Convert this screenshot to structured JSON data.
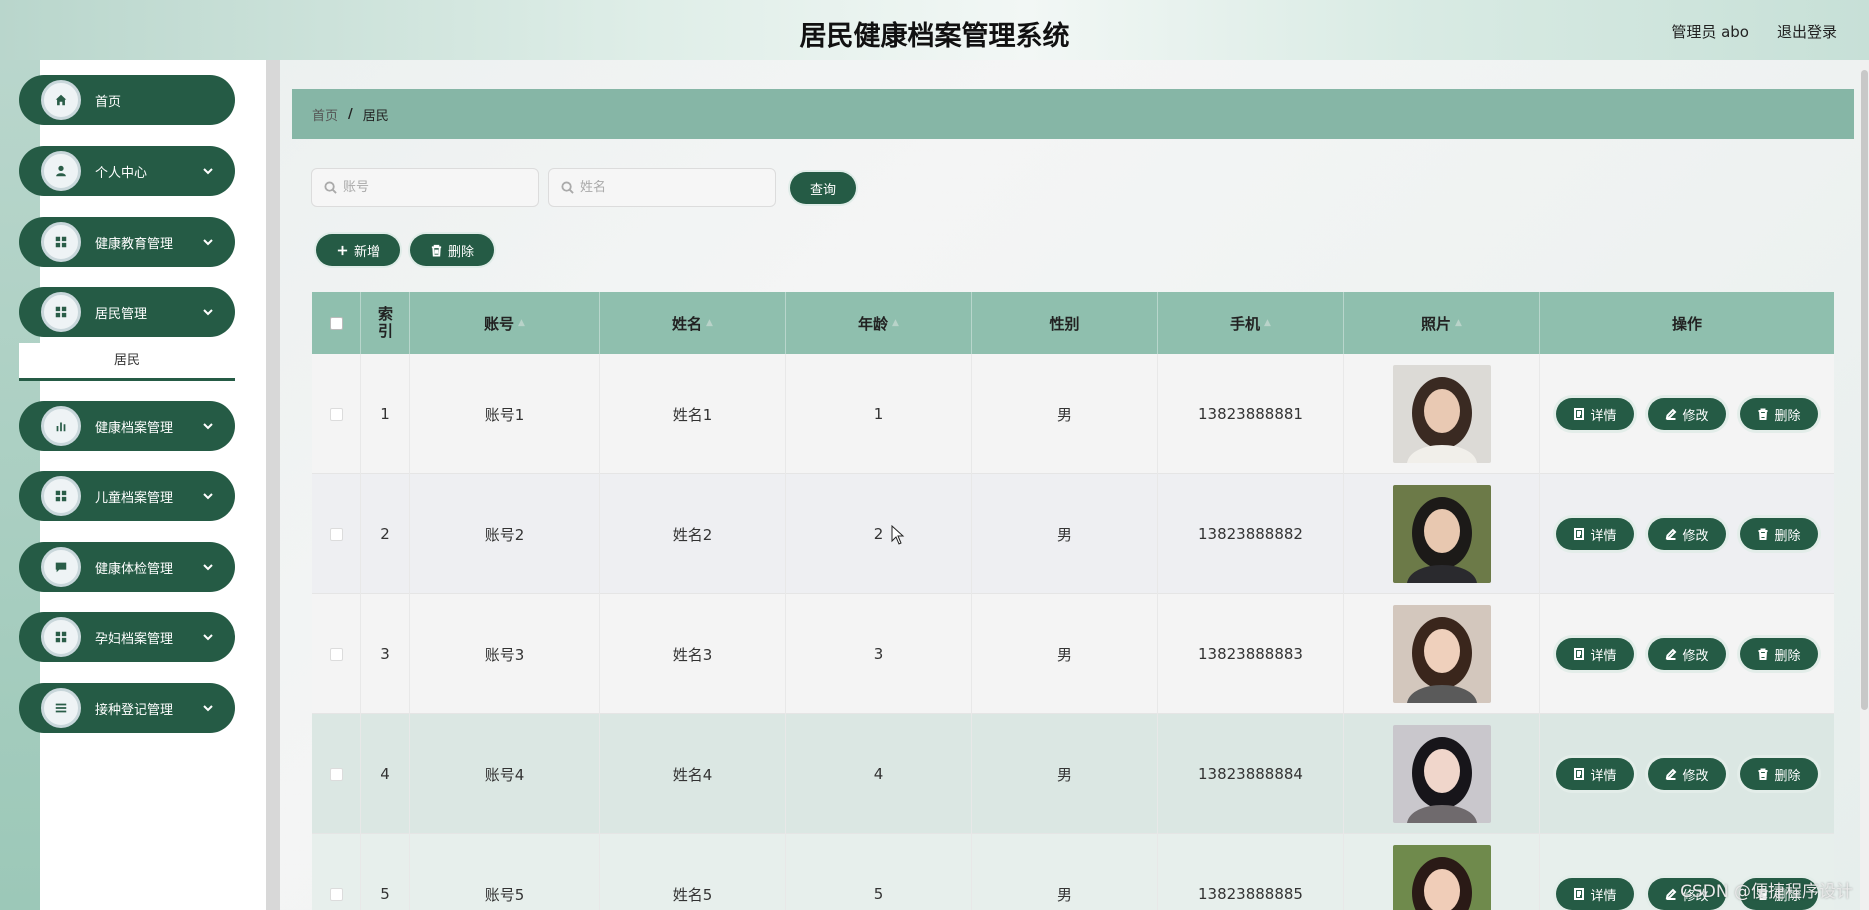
{
  "header": {
    "title": "居民健康档案管理系统",
    "user": "管理员 abo",
    "logout": "退出登录"
  },
  "sidebar": {
    "items": [
      {
        "label": "首页",
        "icon": "home-icon",
        "expandable": false
      },
      {
        "label": "个人中心",
        "icon": "user-icon",
        "expandable": true
      },
      {
        "label": "健康教育管理",
        "icon": "grid-icon",
        "expandable": true
      },
      {
        "label": "居民管理",
        "icon": "grid-icon",
        "expandable": true
      },
      {
        "label": "健康档案管理",
        "icon": "chart-icon",
        "expandable": true
      },
      {
        "label": "儿童档案管理",
        "icon": "grid-icon",
        "expandable": true
      },
      {
        "label": "健康体检管理",
        "icon": "message-icon",
        "expandable": true
      },
      {
        "label": "孕妇档案管理",
        "icon": "grid-icon",
        "expandable": true
      },
      {
        "label": "接种登记管理",
        "icon": "list-icon",
        "expandable": true
      }
    ],
    "sub_item": "居民"
  },
  "breadcrumb": {
    "home": "首页",
    "separator": "/",
    "current": "居民"
  },
  "search": {
    "account_placeholder": "账号",
    "name_placeholder": "姓名",
    "query_label": "查询"
  },
  "actions": {
    "add_label": "新增",
    "delete_label": "删除"
  },
  "table": {
    "headers": [
      "索引",
      "账号",
      "姓名",
      "年龄",
      "性别",
      "手机",
      "照片",
      "操作"
    ],
    "rows": [
      {
        "index": "1",
        "account": "账号1",
        "name": "姓名1",
        "age": "1",
        "gender": "男",
        "phone": "13823888881"
      },
      {
        "index": "2",
        "account": "账号2",
        "name": "姓名2",
        "age": "2",
        "gender": "男",
        "phone": "13823888882"
      },
      {
        "index": "3",
        "account": "账号3",
        "name": "姓名3",
        "age": "3",
        "gender": "男",
        "phone": "13823888883"
      },
      {
        "index": "4",
        "account": "账号4",
        "name": "姓名4",
        "age": "4",
        "gender": "男",
        "phone": "13823888884"
      },
      {
        "index": "5",
        "account": "账号5",
        "name": "姓名5",
        "age": "5",
        "gender": "男",
        "phone": "13823888885"
      }
    ],
    "row_actions": {
      "detail": "详情",
      "edit": "修改",
      "delete": "删除"
    }
  },
  "watermark": "CSDN @便捷程序设计",
  "colors": {
    "primary": "#255b45",
    "header_bg": "#8fbfae",
    "breadcrumb_bg": "#86b6a6"
  }
}
